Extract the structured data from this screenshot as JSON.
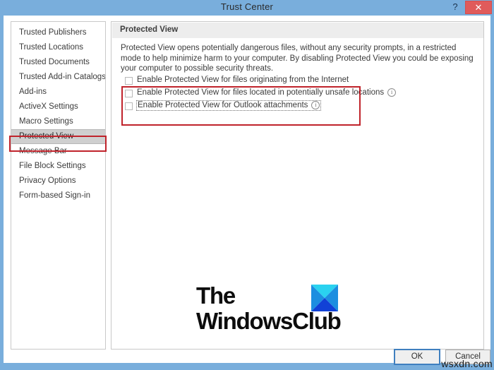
{
  "window": {
    "title": "Trust Center",
    "help_label": "?",
    "close_label": "✕",
    "titlebar_color": "#79aedc",
    "close_color": "#e05b5b"
  },
  "sidebar": {
    "items": [
      {
        "label": "Trusted Publishers",
        "selected": false
      },
      {
        "label": "Trusted Locations",
        "selected": false
      },
      {
        "label": "Trusted Documents",
        "selected": false
      },
      {
        "label": "Trusted Add-in Catalogs",
        "selected": false
      },
      {
        "label": "Add-ins",
        "selected": false
      },
      {
        "label": "ActiveX Settings",
        "selected": false
      },
      {
        "label": "Macro Settings",
        "selected": false
      },
      {
        "label": "Protected View",
        "selected": true
      },
      {
        "label": "Message Bar",
        "selected": false
      },
      {
        "label": "File Block Settings",
        "selected": false
      },
      {
        "label": "Privacy Options",
        "selected": false
      },
      {
        "label": "Form-based Sign-in",
        "selected": false
      }
    ]
  },
  "main": {
    "section_title": "Protected View",
    "description": "Protected View opens potentially dangerous files, without any security prompts, in a restricted mode to help minimize harm to your computer. By disabling Protected View you could be exposing your computer to possible security threats.",
    "checkboxes": [
      {
        "label": "Enable Protected View for files originating from the Internet",
        "checked": false,
        "has_info": false,
        "focused": false
      },
      {
        "label": "Enable Protected View for files located in potentially unsafe locations",
        "checked": false,
        "has_info": true,
        "focused": false
      },
      {
        "label": "Enable Protected View for Outlook attachments",
        "checked": false,
        "has_info": true,
        "focused": true
      }
    ],
    "info_icon_glyph": "i"
  },
  "annotations": {
    "color": "#c0232b",
    "nav_target": "Protected View",
    "checkbox_group_target": "Protected View checkboxes"
  },
  "logo": {
    "line1": "The",
    "line2": "WindowsClub",
    "mark_top_color": "#2ad2f0",
    "mark_left_color": "#1c8ee0",
    "mark_right_color": "#1c8ee0",
    "mark_bottom_color": "#1141d6"
  },
  "footer": {
    "ok_label": "OK",
    "cancel_label": "Cancel"
  },
  "watermark": {
    "text": "wsxdn.com"
  }
}
